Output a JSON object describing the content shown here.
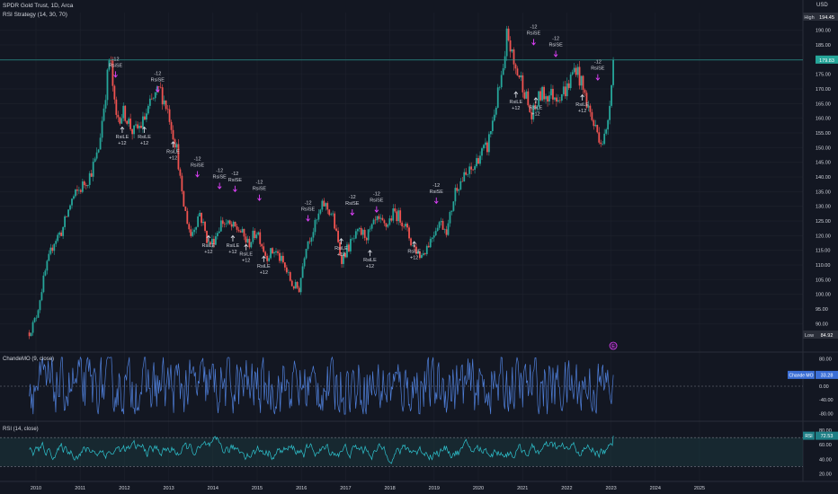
{
  "header": {
    "title": "SPDR Gold Trust, 1D, Arca",
    "strategy": "RSI Strategy (14, 30, 70)",
    "currency": "USD"
  },
  "colors": {
    "background": "#131722",
    "candle_up": "#26a69a",
    "candle_down": "#ef5350",
    "signal": "#e040fb",
    "indicator_line": "#4f7fd9",
    "rsi_line": "#2ec4cf",
    "grid": "#1e222d",
    "last_price_line": "#26a69a"
  },
  "price_badges": {
    "high_label": "High",
    "high_value": "194.45",
    "last_value": "179.83",
    "low_label": "Low",
    "low_value": "84.92"
  },
  "event_badge": "E",
  "pane2": {
    "label": "ChandeMO (9, close)",
    "badge": "Chande MO",
    "badge_value": "33.28"
  },
  "pane3": {
    "label": "RSI (14, close)",
    "badge": "RSI",
    "badge_value": "72.53"
  },
  "chart_data": [
    {
      "type": "candlestick",
      "title": "SPDR Gold Trust, 1D, Arca",
      "ylim": [
        84,
        196
      ],
      "yticks": [
        90,
        95,
        100,
        105,
        110,
        115,
        120,
        125,
        130,
        135,
        140,
        145,
        150,
        155,
        160,
        165,
        170,
        175,
        180,
        185,
        190
      ],
      "x_ticks": [
        "2010",
        "2011",
        "2012",
        "2013",
        "2014",
        "2015",
        "2016",
        "2017",
        "2018",
        "2019",
        "2020",
        "2021",
        "2022",
        "2023",
        "2024",
        "2025"
      ],
      "series": [
        {
          "name": "Close",
          "x": [
            2009.85,
            2010.0,
            2010.2,
            2010.4,
            2010.6,
            2010.8,
            2011.0,
            2011.2,
            2011.4,
            2011.6,
            2011.67,
            2011.8,
            2012.0,
            2012.2,
            2012.4,
            2012.6,
            2012.8,
            2013.0,
            2013.2,
            2013.3,
            2013.5,
            2013.7,
            2013.9,
            2014.0,
            2014.2,
            2014.4,
            2014.6,
            2014.8,
            2015.0,
            2015.2,
            2015.4,
            2015.6,
            2015.8,
            2015.95,
            2016.1,
            2016.3,
            2016.5,
            2016.7,
            2016.9,
            2017.1,
            2017.3,
            2017.5,
            2017.7,
            2017.9,
            2018.1,
            2018.3,
            2018.5,
            2018.7,
            2018.9,
            2019.1,
            2019.3,
            2019.5,
            2019.7,
            2019.9,
            2020.0,
            2020.2,
            2020.4,
            2020.6,
            2020.65,
            2020.8,
            2021.0,
            2021.2,
            2021.4,
            2021.6,
            2021.8,
            2022.0,
            2022.2,
            2022.4,
            2022.6,
            2022.8,
            2022.9,
            2023.0,
            2023.05
          ],
          "values": [
            87,
            92,
            107,
            118,
            122,
            132,
            136,
            140,
            148,
            172,
            182,
            160,
            162,
            155,
            158,
            165,
            170,
            162,
            148,
            133,
            120,
            128,
            117,
            118,
            125,
            123,
            122,
            117,
            122,
            113,
            115,
            110,
            103,
            102,
            117,
            123,
            131,
            127,
            112,
            117,
            121,
            120,
            125,
            123,
            128,
            125,
            117,
            113,
            118,
            125,
            122,
            137,
            140,
            143,
            147,
            150,
            165,
            178,
            190,
            178,
            172,
            160,
            168,
            168,
            168,
            170,
            178,
            168,
            158,
            152,
            155,
            172,
            179.83
          ]
        }
      ],
      "annotations": [
        {
          "text": "-12",
          "text2": "RsiSE",
          "x": 2011.8,
          "y": 176
        },
        {
          "text": "RsiLE",
          "text2": "+12",
          "x": 2011.95,
          "y": 155
        },
        {
          "text": "RsiLE",
          "text2": "+12",
          "x": 2012.45,
          "y": 155
        },
        {
          "text": "-12",
          "text2": "RsiSE",
          "x": 2012.75,
          "y": 171
        },
        {
          "text": "RsiLE",
          "text2": "+12",
          "x": 2013.1,
          "y": 150
        },
        {
          "text": "-12",
          "text2": "RsiSE",
          "x": 2013.65,
          "y": 142
        },
        {
          "text": "RsiLE",
          "text2": "+12",
          "x": 2013.9,
          "y": 118
        },
        {
          "text": "-12",
          "text2": "RsiSE",
          "x": 2014.15,
          "y": 138
        },
        {
          "text": "-12",
          "text2": "RsiSE",
          "x": 2014.5,
          "y": 137
        },
        {
          "text": "RsiLE",
          "text2": "+12",
          "x": 2014.45,
          "y": 118
        },
        {
          "text": "RsiLE",
          "text2": "+12",
          "x": 2014.75,
          "y": 115
        },
        {
          "text": "-12",
          "text2": "RsiSE",
          "x": 2015.05,
          "y": 134
        },
        {
          "text": "RsiLE",
          "text2": "+12",
          "x": 2015.15,
          "y": 111
        },
        {
          "text": "-12",
          "text2": "RsiSE",
          "x": 2016.15,
          "y": 127
        },
        {
          "text": "RsiLE",
          "text2": "+12",
          "x": 2016.9,
          "y": 117
        },
        {
          "text": "-12",
          "text2": "RsiSE",
          "x": 2017.15,
          "y": 129
        },
        {
          "text": "RsiLE",
          "text2": "+12",
          "x": 2017.55,
          "y": 113
        },
        {
          "text": "-12",
          "text2": "RsiSE",
          "x": 2017.7,
          "y": 130
        },
        {
          "text": "RsiLE",
          "text2": "+12",
          "x": 2018.55,
          "y": 116
        },
        {
          "text": "-12",
          "text2": "RsiSE",
          "x": 2019.05,
          "y": 133
        },
        {
          "text": "RsiLE",
          "text2": "+12",
          "x": 2020.85,
          "y": 167
        },
        {
          "text": "-12",
          "text2": "RsiSE",
          "x": 2021.25,
          "y": 187
        },
        {
          "text": "RsiLE",
          "text2": "+12",
          "x": 2021.3,
          "y": 165
        },
        {
          "text": "-12",
          "text2": "RsiSE",
          "x": 2021.75,
          "y": 183
        },
        {
          "text": "RsiLE",
          "text2": "+12",
          "x": 2022.35,
          "y": 166
        },
        {
          "text": "-12",
          "text2": "RsiSE",
          "x": 2022.7,
          "y": 175
        }
      ]
    },
    {
      "type": "line",
      "title": "ChandeMO (9, close)",
      "ylim": [
        -95,
        95
      ],
      "yticks": [
        80,
        40,
        0,
        -40,
        -80
      ],
      "ytick_labels": [
        "80.00",
        "40.00",
        "0.00",
        "-40.00",
        "-80.00"
      ],
      "reference_lines": [
        0
      ],
      "last_value": 33.28
    },
    {
      "type": "line",
      "title": "RSI (14, close)",
      "ylim": [
        12,
        90
      ],
      "yticks": [
        80,
        60,
        40,
        20
      ],
      "ytick_labels": [
        "80.00",
        "60.00",
        "40.00",
        "20.00"
      ],
      "reference_lines": [
        70,
        30
      ],
      "band": [
        30,
        70
      ],
      "last_value": 72.53
    }
  ]
}
